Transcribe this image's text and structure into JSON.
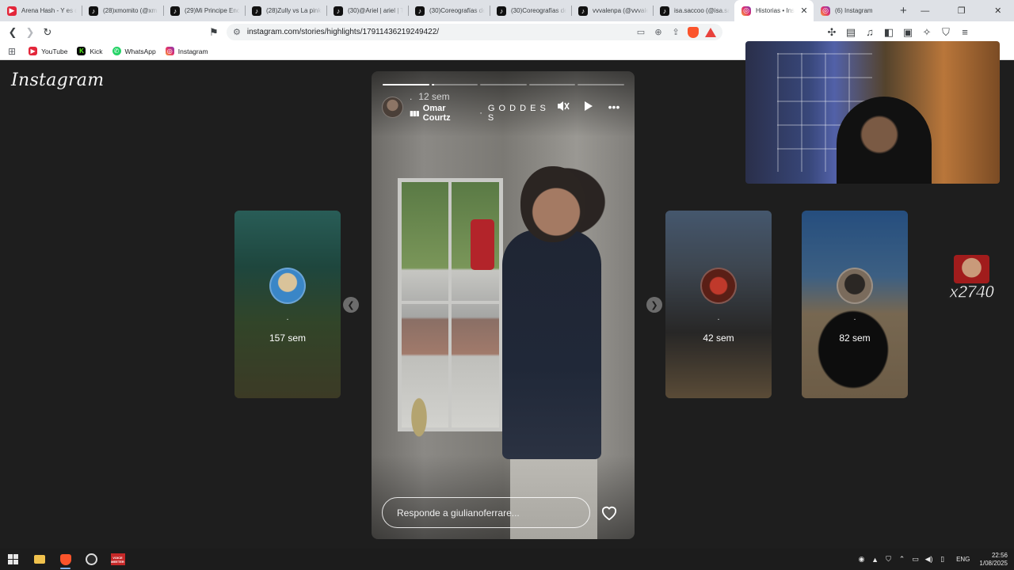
{
  "browser": {
    "tabs": [
      {
        "title": "Arena Hash - Y es q",
        "favicon": "youtube-icon",
        "active": false
      },
      {
        "title": "(28)xmomito (@xm",
        "favicon": "tiktok-icon",
        "active": false
      },
      {
        "title": "(29)Mi Principe Enc",
        "favicon": "tiktok-icon",
        "active": false
      },
      {
        "title": "(28)Zully vs La pink",
        "favicon": "tiktok-icon",
        "active": false
      },
      {
        "title": "(30)@Ariel | ariel | T",
        "favicon": "tiktok-icon",
        "active": false
      },
      {
        "title": "(30)Coreografías de",
        "favicon": "tiktok-icon",
        "active": false
      },
      {
        "title": "(30)Coreografías de",
        "favicon": "tiktok-icon",
        "active": false
      },
      {
        "title": "vvvalenpa (@vvvale",
        "favicon": "tiktok-icon",
        "active": false
      },
      {
        "title": "isa.saccoo (@isa.sa",
        "favicon": "tiktok-icon",
        "active": false
      },
      {
        "title": "Historias • Insta",
        "favicon": "instagram-icon",
        "active": true
      },
      {
        "title": "(6) Instagram",
        "favicon": "instagram-icon",
        "active": false
      }
    ],
    "url": "instagram.com/stories/highlights/17911436219249422/",
    "bookmarks": [
      {
        "label": "YouTube",
        "icon": "youtube-icon"
      },
      {
        "label": "Kick",
        "icon": "kick-icon"
      },
      {
        "label": "WhatsApp",
        "icon": "whatsapp-icon"
      },
      {
        "label": "Instagram",
        "icon": "instagram-icon"
      }
    ]
  },
  "page": {
    "logo": "Instagram",
    "story": {
      "segments": 5,
      "progress_current_segment": 0.05,
      "dot": ".",
      "time": "12 sem",
      "song_artist": "Omar Courtz",
      "song_separator": "·",
      "song_title": "G O D D E S S",
      "reply_placeholder": "Responde a giulianoferrare..."
    },
    "side_cards": [
      {
        "dot": ".",
        "time": "157 sem"
      },
      {
        "dot": ".",
        "time": "42 sem"
      },
      {
        "dot": ".",
        "time": "82 sem"
      }
    ],
    "overlay_counter": "x2740"
  },
  "taskbar": {
    "language": "ENG",
    "time": "22:56",
    "date": "1/08/2025",
    "voicemeeter_label_top": "VOICE",
    "voicemeeter_label_bottom": "MEETER"
  },
  "colors": {
    "page_bg": "#1e1e1e",
    "tabstrip_bg": "#dee1e6",
    "taskbar_bg": "#1c1c1c"
  }
}
